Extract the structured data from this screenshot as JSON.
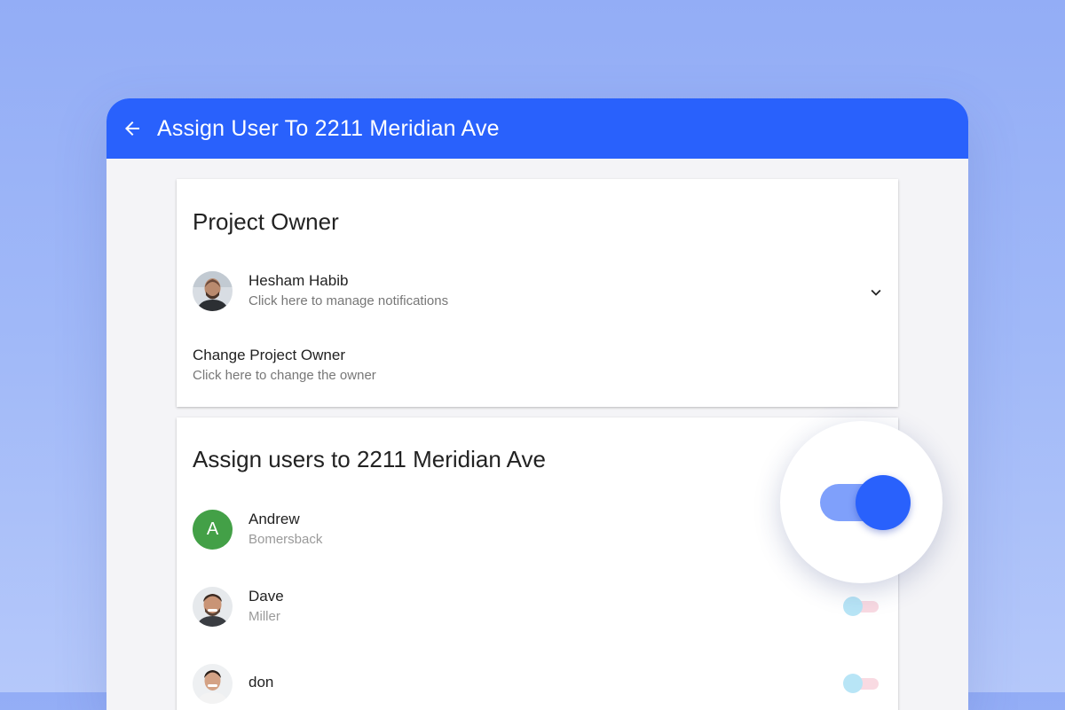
{
  "appbar": {
    "title": "Assign User To 2211 Meridian Ave",
    "back_icon": "arrow-left-icon"
  },
  "owner_card": {
    "title": "Project Owner",
    "owner": {
      "name": "Hesham Habib",
      "subtitle": "Click here to manage notifications"
    },
    "change": {
      "title": "Change Project Owner",
      "subtitle": "Click here to change the owner"
    }
  },
  "assign_card": {
    "title": "Assign users to 2211 Meridian Ave",
    "users": [
      {
        "avatar_letter": "A",
        "first": "Andrew",
        "last": "Bomersback",
        "enabled": true
      },
      {
        "first": "Dave",
        "last": "Miller",
        "enabled": false
      },
      {
        "first": "don",
        "last": "",
        "enabled": false
      }
    ]
  },
  "colors": {
    "primary": "#2961fc",
    "avatar_green": "#43a047",
    "toggle_track_on": "#7fa0fb"
  }
}
